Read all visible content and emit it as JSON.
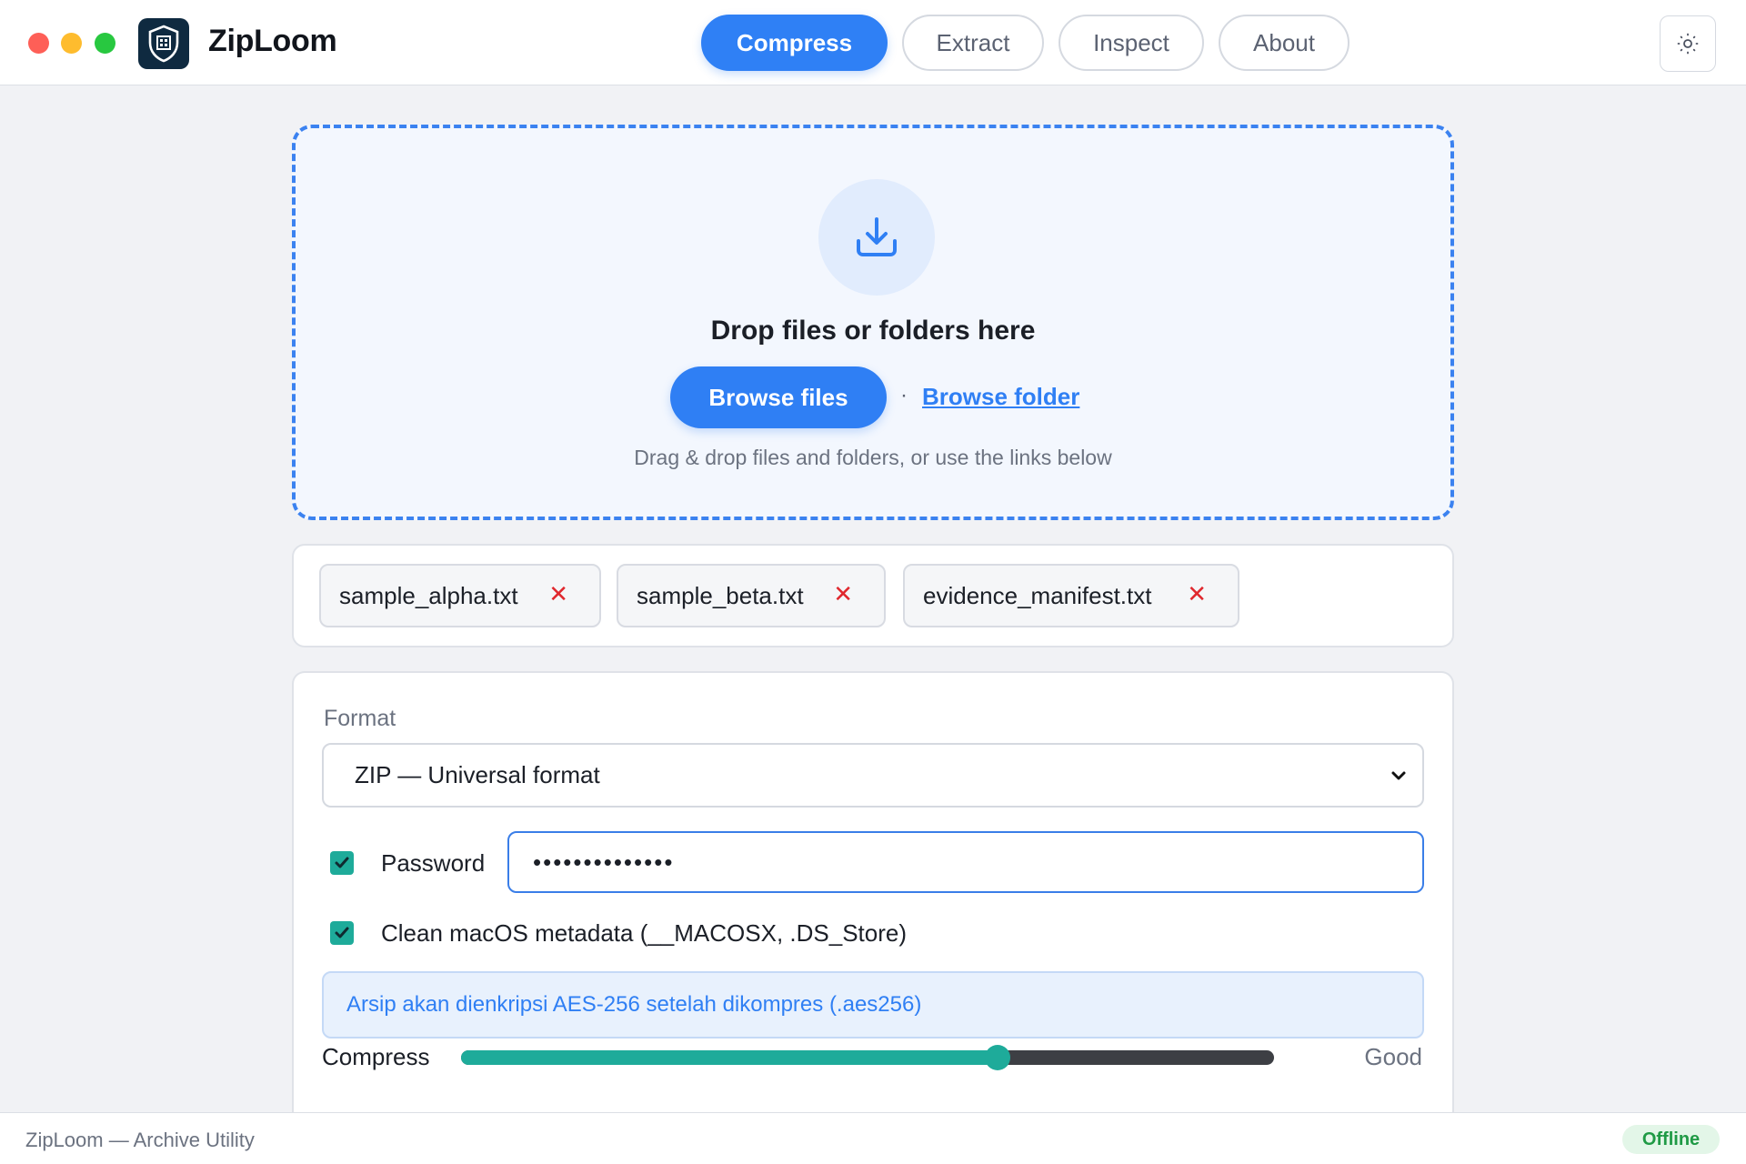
{
  "app": {
    "title": "ZipLoom",
    "logo_icon": "shield-qr-icon"
  },
  "tabs": [
    {
      "label": "Compress",
      "active": true
    },
    {
      "label": "Extract",
      "active": false
    },
    {
      "label": "Inspect",
      "active": false
    },
    {
      "label": "About",
      "active": false
    }
  ],
  "header": {
    "settings_icon": "brightness-icon"
  },
  "dropzone": {
    "icon": "download-tray-icon",
    "title": "Drop files or folders here",
    "browse_files_label": "Browse files",
    "separator": "·",
    "browse_folder_label": "Browse folder",
    "hint": "Drag & drop files and folders, or use the links below"
  },
  "files": [
    {
      "name": "sample_alpha.txt",
      "remove": "✕"
    },
    {
      "name": "sample_beta.txt",
      "remove": "✕"
    },
    {
      "name": "evidence_manifest.txt",
      "remove": "✕"
    }
  ],
  "options": {
    "format_label": "Format",
    "format_value": "ZIP — Universal format",
    "password_checked": true,
    "password_label": "Password",
    "password_value": "••••••••••••••",
    "clean_checked": true,
    "clean_label": "Clean macOS metadata (__MACOSX, .DS_Store)",
    "info_text": "Arsip akan dienkripsi AES-256 setelah dikompres (.aes256)",
    "compress_label": "Compress",
    "compress_level": 0.66,
    "compress_value_label": "Good"
  },
  "footer": {
    "text": "ZipLoom — Archive Utility",
    "status": "Offline"
  },
  "colors": {
    "accent": "#2f7ff4",
    "teal": "#1eab9a",
    "danger": "#e0282e",
    "status_green": "#1f9a45"
  }
}
